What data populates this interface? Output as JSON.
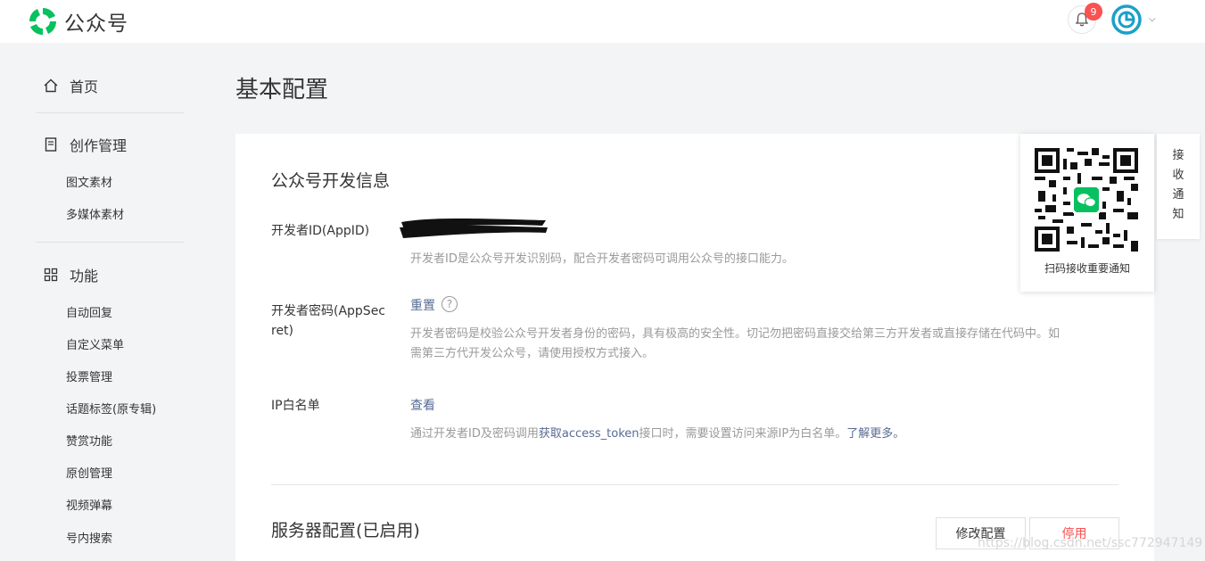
{
  "header": {
    "app_name": "公众号",
    "notification_count": "9",
    "colors": {
      "brand": "#07c160",
      "badge": "#fa5151"
    }
  },
  "sidebar": {
    "home": "首页",
    "creation": {
      "label": "创作管理",
      "items": [
        "图文素材",
        "多媒体素材"
      ]
    },
    "features": {
      "label": "功能",
      "items": [
        "自动回复",
        "自定义菜单",
        "投票管理",
        "话题标签(原专辑)",
        "赞赏功能",
        "原创管理",
        "视频弹幕",
        "号内搜索"
      ]
    }
  },
  "main": {
    "page_title": "基本配置",
    "dev_info": {
      "title": "公众号开发信息",
      "appid": {
        "label": "开发者ID(AppID)",
        "desc": "开发者ID是公众号开发识别码，配合开发者密码可调用公众号的接口能力。"
      },
      "appsecret": {
        "label": "开发者密码(AppSecret)",
        "label_line1": "开发者密码(AppSec",
        "label_line2": "ret)",
        "action": "重置",
        "help": "?",
        "desc_line1": "开发者密码是校验公众号开发者身份的密码，具有极高的安全性。切记勿把密码直接交给第三方开发者或直接存储在代码中。如",
        "desc_line2": "需第三方代开发公众号，请使用授权方式接入。"
      },
      "ip_whitelist": {
        "label": "IP白名单",
        "action": "查看",
        "desc_prefix": "通过开发者ID及密码调用",
        "desc_link": "获取access_token",
        "desc_middle": "接口时，需要设置访问来源IP为白名单。",
        "desc_more": "了解更多。"
      }
    },
    "server_config": {
      "title": "服务器配置(已启用)",
      "edit_button": "修改配置",
      "stop_button": "停用"
    }
  },
  "qr_popup": {
    "caption": "扫码接收重要通知"
  },
  "notify_tab": {
    "chars": [
      "接",
      "收",
      "通",
      "知"
    ]
  },
  "watermark": "https://blog.csdn.net/ssc772947149"
}
